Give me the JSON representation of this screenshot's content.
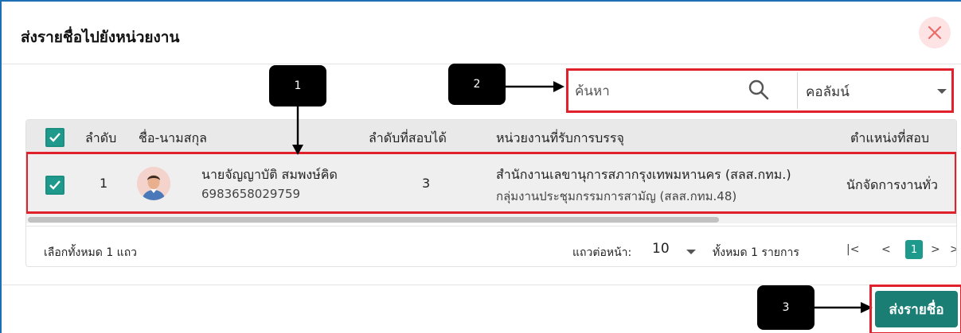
{
  "dialog": {
    "title": "ส่งรายชื่อไปยังหน่วยงาน",
    "close_icon": "close-icon"
  },
  "search": {
    "placeholder": "ค้นหา",
    "column_select": "คอลัมน์"
  },
  "table": {
    "headers": [
      "ลำดับ",
      "ชื่อ-นามสกุล",
      "ลำดับที่สอบได้",
      "หน่วยงานที่รับการบรรจุ",
      "ตำแหน่งที่สอบ"
    ],
    "rows": [
      {
        "order": "1",
        "name": "นายจัญญาบัติ สมพงษ์คิด",
        "id_number": "6983658029759",
        "rank": "3",
        "agency": "สำนักงานเลขานุการสภากรุงเทพมหานคร (สลส.กทม.)",
        "sub_agency": "กลุ่มงานประชุมกรรมการสามัญ (สลส.กทม.48)",
        "position": "นักจัดการงานทั่ว"
      }
    ]
  },
  "footer": {
    "selected_text": "เลือกทั้งหมด 1 แถว",
    "rows_per_page_label": "แถวต่อหน้า:",
    "rows_per_page_value": "10",
    "total_text": "ทั้งหมด 1 รายการ",
    "current_page": "1"
  },
  "callouts": [
    "1",
    "2",
    "3"
  ],
  "actions": {
    "send_label": "ส่งรายชื่อ"
  },
  "colors": {
    "accent": "#1d9a8c",
    "highlight": "#e0202a",
    "primary_button": "#1a7e74"
  }
}
